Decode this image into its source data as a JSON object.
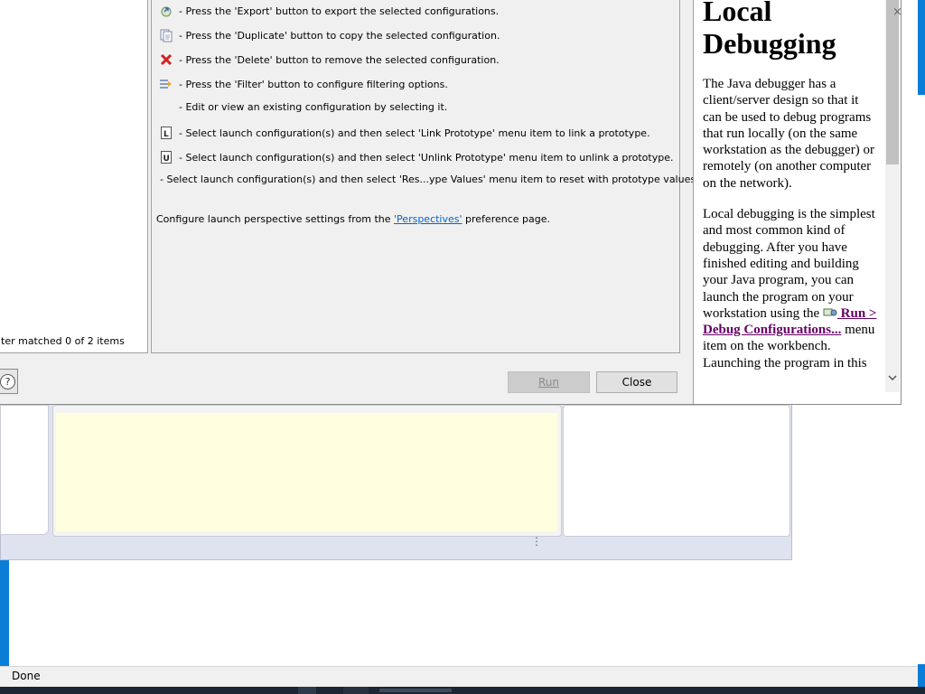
{
  "status_bar": {
    "text": "Done"
  },
  "tree": {
    "filter_status": "ter matched 0 of 2 items"
  },
  "instructions": [
    {
      "icon": "export-icon",
      "text": "- Press the 'Export' button to export the selected configurations."
    },
    {
      "icon": "duplicate-icon",
      "text": "- Press the 'Duplicate' button to copy the selected configuration."
    },
    {
      "icon": "delete-icon",
      "text": "- Press the 'Delete' button to remove the selected configuration."
    },
    {
      "icon": "filter-icon",
      "text": "- Press the 'Filter' button to configure filtering options."
    },
    {
      "icon": "",
      "text": "- Edit or view an existing configuration by selecting it."
    },
    {
      "icon": "link-prototype-icon",
      "text": "- Select launch configuration(s) and then select 'Link Prototype' menu item to link a prototype."
    },
    {
      "icon": "unlink-prototype-icon",
      "text": "- Select launch configuration(s) and then select 'Unlink Prototype' menu item to unlink a prototype."
    },
    {
      "icon": "",
      "text": "- Select launch configuration(s) and then select 'Res...ype Values' menu item to reset with prototype values."
    }
  ],
  "perspectives": {
    "prefix": "Configure launch perspective settings from the ",
    "link": "'Perspectives'",
    "suffix": " preference page."
  },
  "buttons": {
    "run": "Run",
    "close": "Close",
    "help": "?"
  },
  "help": {
    "title": "Local Debugging",
    "p1": "The Java debugger has a client/server design so that it can be used to debug programs that run locally (on the same workstation as the debugger) or remotely (on another computer on the network).",
    "p2_before": "Local debugging is the simplest and most common kind of debugging.  After you have finished editing and building your Java program, you can launch the program on your workstation using the ",
    "p2_link": " Run > Debug Configurations...",
    "p2_after": " menu item on the workbench.",
    "p3_partial": "Launching the program in this"
  },
  "colors": {
    "link": "#0066cc",
    "visited_link": "#660066",
    "desktop": "#0a7ed6"
  }
}
